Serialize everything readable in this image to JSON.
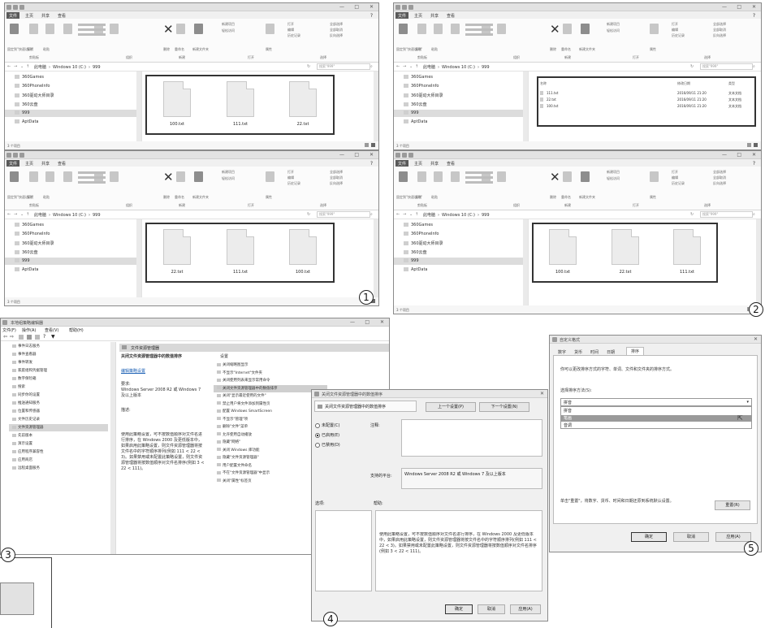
{
  "explorer": {
    "menu": [
      "文件",
      "主页",
      "共享",
      "查看"
    ],
    "breadcrumb": [
      "此电脑",
      "Windows 10 (C:)",
      "999"
    ],
    "search_placeholder": "搜索\"999\"",
    "nav_items": [
      "360Games",
      "360PhoneInfo",
      "360驱动大师目录",
      "360云盘",
      "999",
      "AptData"
    ],
    "status_text": "3 个项目",
    "ribbon_groups": [
      "剪贴板",
      "组织",
      "新建",
      "打开",
      "选择"
    ],
    "ribbon_labels": {
      "pin": "固定到\"快速访问\"",
      "copy": "复制",
      "paste": "粘贴",
      "delete": "删除",
      "rename": "重命名",
      "new_folder": "新建文件夹",
      "new_item": "新建项目",
      "easy_access": "轻松访问",
      "properties": "属性",
      "open": "打开",
      "edit": "编辑",
      "history": "历史记录",
      "select_all": "全部选择",
      "select_none": "全部取消",
      "invert": "反向选择"
    },
    "list_headers": [
      "名称",
      "修改日期",
      "类型"
    ],
    "list_date": "2016/09/11 21:20",
    "list_type": "文本文档"
  },
  "panel1_top": {
    "files": [
      "100.txt",
      "111.txt",
      "22.txt"
    ]
  },
  "panel1_bottom": {
    "files": [
      "22.txt",
      "111.txt",
      "100.txt"
    ]
  },
  "panel2_top": {
    "files": [
      "111.txt",
      "22.txt",
      "100.txt"
    ]
  },
  "panel2_bottom": {
    "files": [
      "100.txt",
      "22.txt",
      "111.txt"
    ]
  },
  "gpedit": {
    "title": "本地组策略编辑器",
    "menu": [
      "文件(F)",
      "操作(A)",
      "查看(V)",
      "帮助(H)"
    ],
    "tree": [
      "事件日志服务",
      "事件查看器",
      "事件转发",
      "家庭组和凭据管理",
      "数字保险箱",
      "搜索",
      "同步你的设置",
      "推送通知服务",
      "位置和传感器",
      "文件历史记录",
      "文件资源管理器",
      "先前版本",
      "演示设置",
      "应用程序兼容性",
      "应用商店",
      "远程桌面服务"
    ],
    "tree_selected": "文件资源管理器",
    "header": "文件资源管理器",
    "policy_title": "关闭文件资源管理器中的数值排序",
    "edit_link": "编辑策略设置",
    "req_label": "要求:",
    "req_text": "Windows Server 2008 R2 或 Windows 7 及以上版本",
    "desc_label": "描述:",
    "desc_text": "使用此策略设置，可不按数值顺序对文件名进行排序，在 Windows 2000 及更低版本中，如果启用此策略设置，则文件资源管理器将按文件名中的字符顺序排列(例如 111 < 22 < 3)。如果禁用或未配置此策略设置，则文件资源管理器将按数值顺序对文件名排序(例如 3 < 22 < 111)。",
    "settings_header": "设置",
    "settings": [
      "关闭缩略图显示",
      "不显示\"Internet\"文件夹",
      "关闭使用列表来显示常用命令",
      "关闭文件资源管理器中的数值排序",
      "关闭\"显示最近使用的文件\"",
      "禁止用户将文件添加到属性页",
      "配置 Windows SmartScreen",
      "不显示\"管理\"项",
      "删除\"文件\"菜单",
      "允许使用自动播放",
      "隐藏\"网络\"",
      "关闭 Windows 库功能",
      "隐藏\"文件资源管理器\"",
      "用户配置文件命名",
      "不在\"文件资源管理器\"中显示",
      "关闭\"属性\"标签页"
    ]
  },
  "dialog": {
    "title": "关闭文件资源管理器中的数值排序",
    "policy_name": "关闭文件资源管理器中的数值排序",
    "prev_button": "上一个设置(P)",
    "next_button": "下一个设置(N)",
    "radios": [
      "未配置(C)",
      "已启用(E)",
      "已禁用(D)"
    ],
    "selected_radio": 1,
    "comment_label": "注释:",
    "supported_label": "支持的平台:",
    "supported_text": "Windows Server 2008 R2 或 Windows 7 及以上版本",
    "options_label": "选项:",
    "help_label": "帮助:",
    "help_text": "使用此策略设置，可不按数值顺序对文件名进行排序，在 Windows 2000 及更低版本中，如果启用此策略设置，则文件资源管理器将按文件名中的字符顺序排列(例如 111 < 22 < 3)。如果禁用或未配置此策略设置，则文件资源管理器将按数值顺序对文件名排序(例如 3 < 22 < 111)。",
    "ok": "确定",
    "cancel": "取消",
    "apply": "应用(A)"
  },
  "region": {
    "title": "自定义格式",
    "tabs": [
      "数字",
      "货币",
      "时间",
      "日期",
      "排序"
    ],
    "selected_tab": "排序",
    "intro": "你可以更改排序方式的字符、单词、文件和文件夹的排序方式。",
    "method_label": "选择排序方法(S):",
    "dropdown_value": "拼音",
    "options": [
      "拼音",
      "笔画",
      "音调"
    ],
    "highlighted_option": "笔画",
    "reset_text": "单击\"重置\"，将数字、货币、时间和日期还原到系统默认设置。",
    "reset_button": "重置(R)",
    "ok": "确定",
    "cancel": "取消",
    "apply": "应用(A)"
  },
  "badges": [
    "1",
    "2",
    "3",
    "4",
    "5"
  ]
}
